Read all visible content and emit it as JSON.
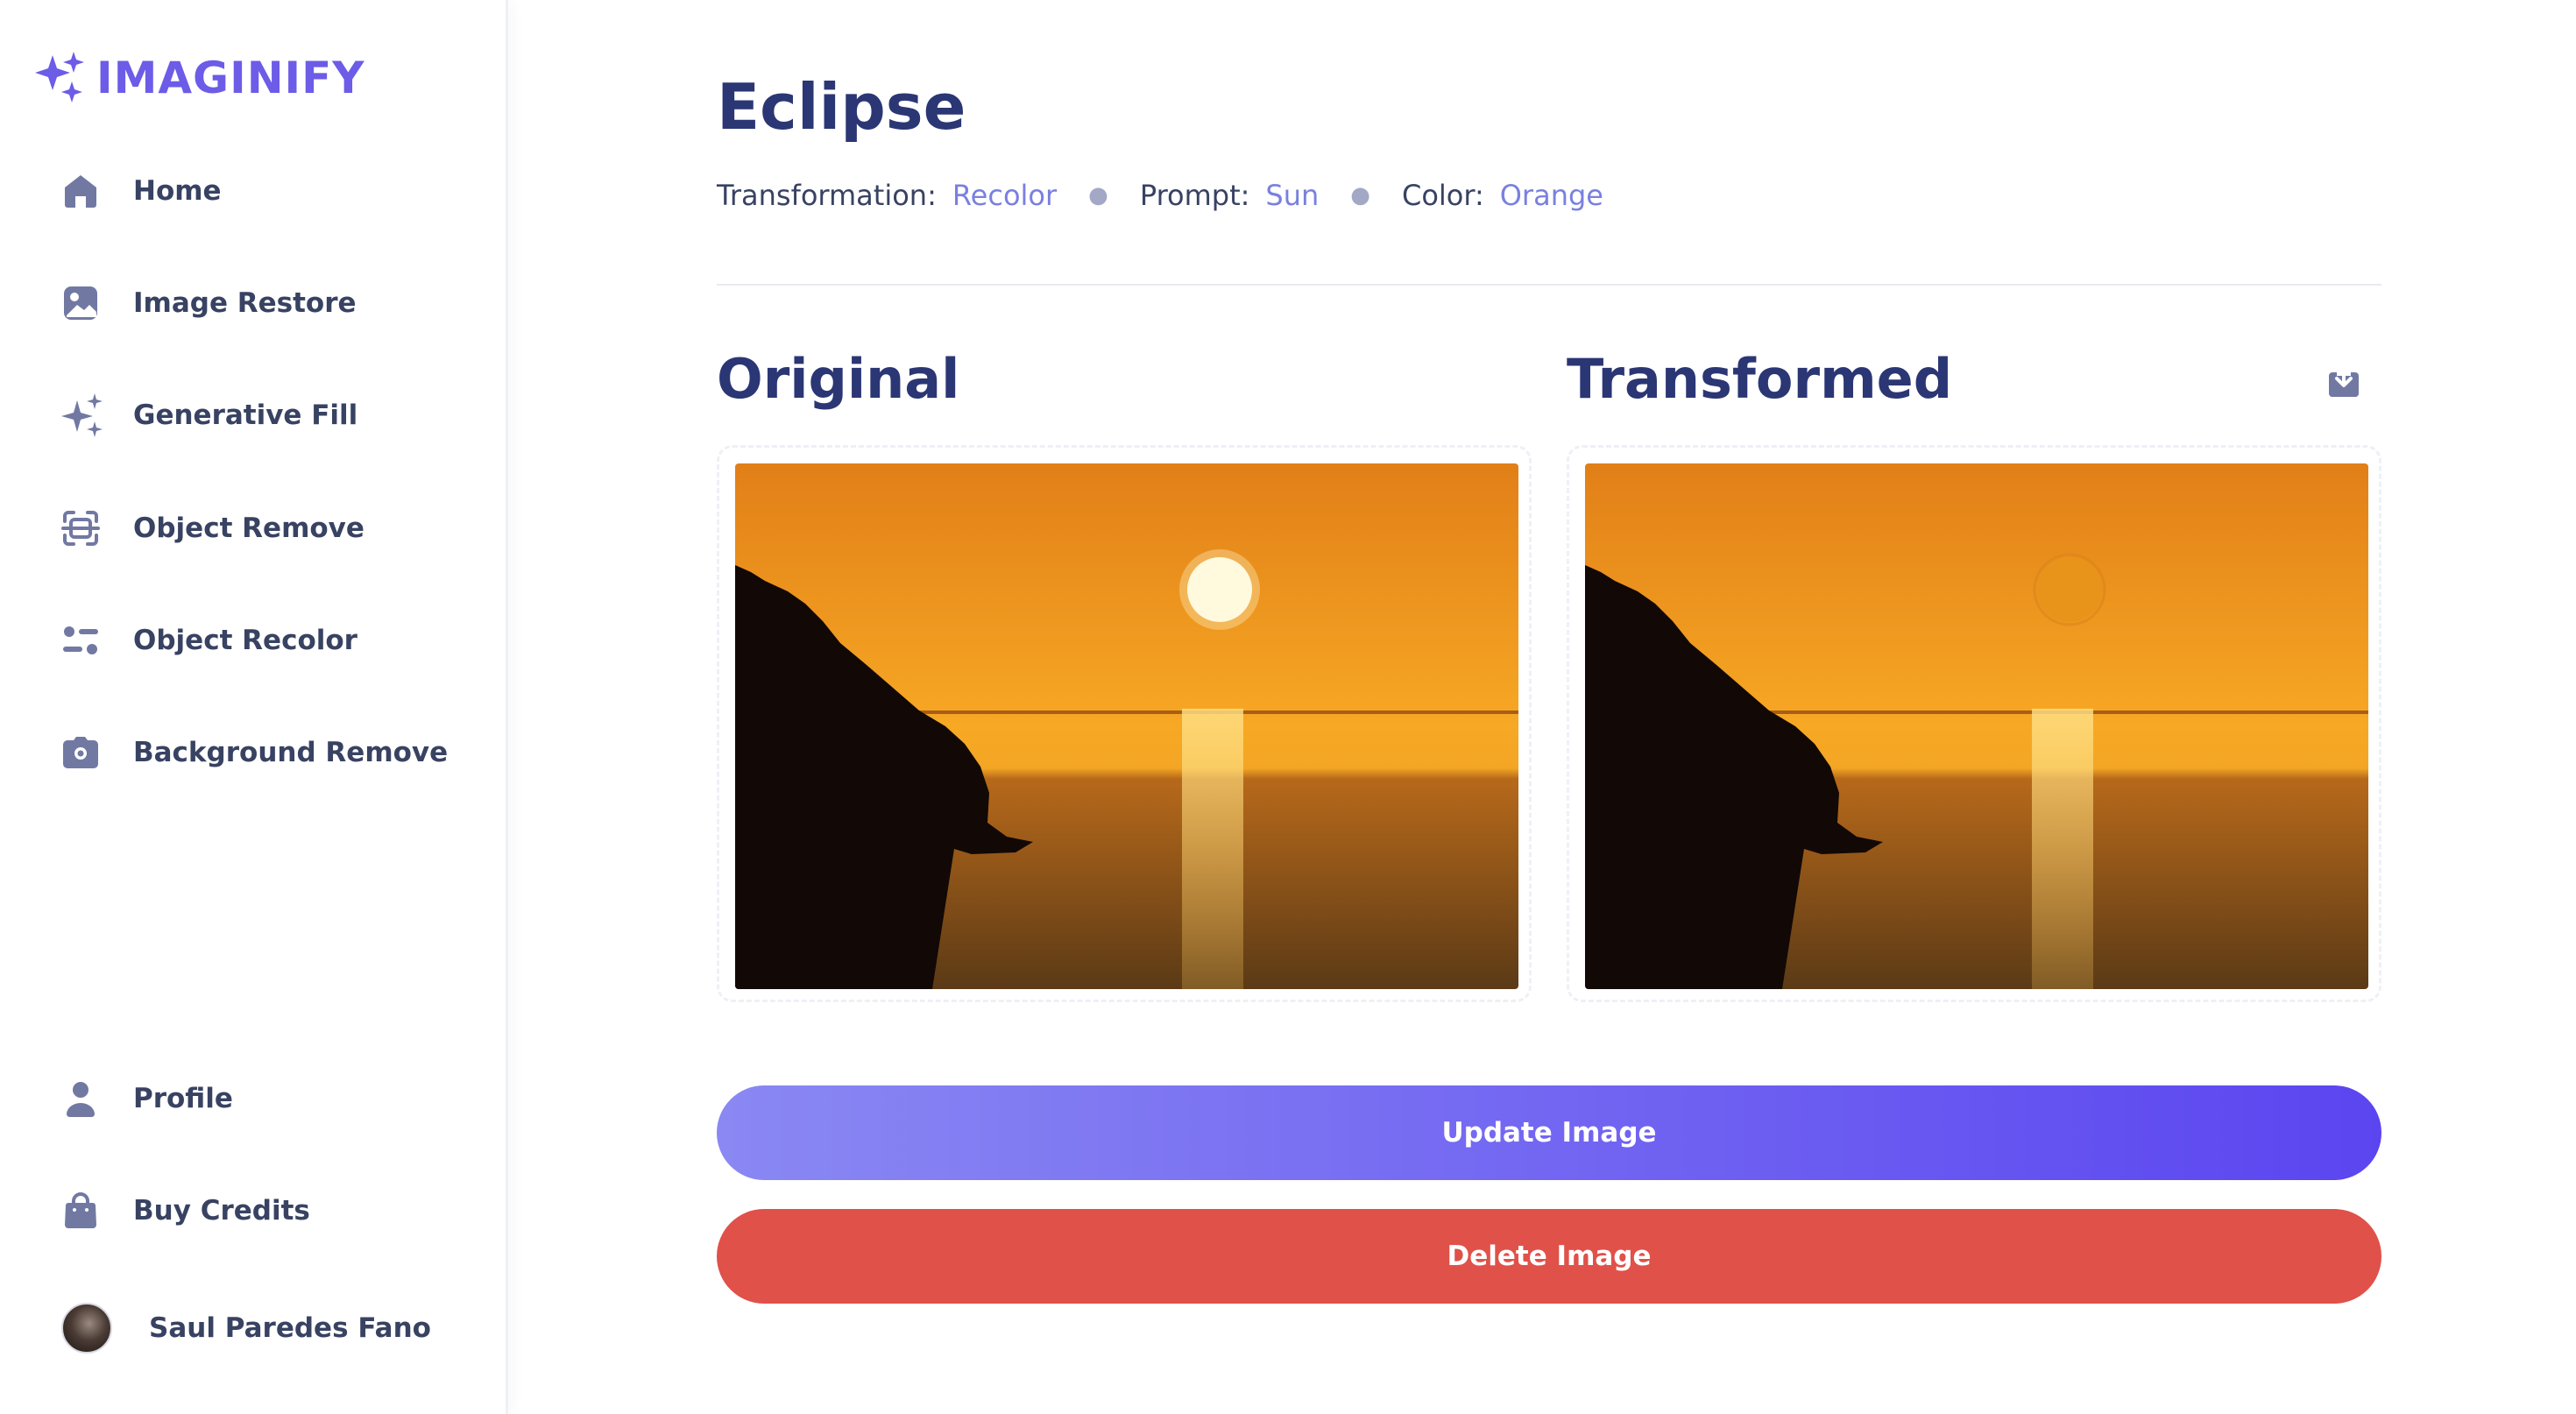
{
  "app": {
    "logo_text": "IMAGINIFY",
    "logo_icon": "sparkles-icon",
    "brand_color": "#6c5ce7"
  },
  "sidebar": {
    "items": [
      {
        "label": "Home",
        "icon": "home-icon"
      },
      {
        "label": "Image Restore",
        "icon": "image-icon"
      },
      {
        "label": "Generative Fill",
        "icon": "stars-icon"
      },
      {
        "label": "Object Remove",
        "icon": "scan-icon"
      },
      {
        "label": "Object Recolor",
        "icon": "filter-icon"
      },
      {
        "label": "Background Remove",
        "icon": "camera-icon"
      }
    ],
    "bottom_items": [
      {
        "label": "Profile",
        "icon": "user-icon"
      },
      {
        "label": "Buy Credits",
        "icon": "bag-icon"
      }
    ],
    "user": {
      "name": "Saul Paredes Fano",
      "icon": "avatar"
    }
  },
  "main": {
    "title": "Eclipse",
    "meta": {
      "transformation_label": "Transformation:",
      "transformation_value": "Recolor",
      "prompt_label": "Prompt:",
      "prompt_value": "Sun",
      "color_label": "Color:",
      "color_value": "Orange",
      "separator": "●"
    },
    "original_title": "Original",
    "transformed_title": "Transformed",
    "download_icon": "download-icon",
    "update_button": "Update Image",
    "delete_button": "Delete Image"
  },
  "colors": {
    "heading": "#2b3674",
    "accent_value": "#7a80e0",
    "update_gradient_start": "#8a88f3",
    "update_gradient_end": "#5b45f0",
    "delete": "#e0514a"
  }
}
